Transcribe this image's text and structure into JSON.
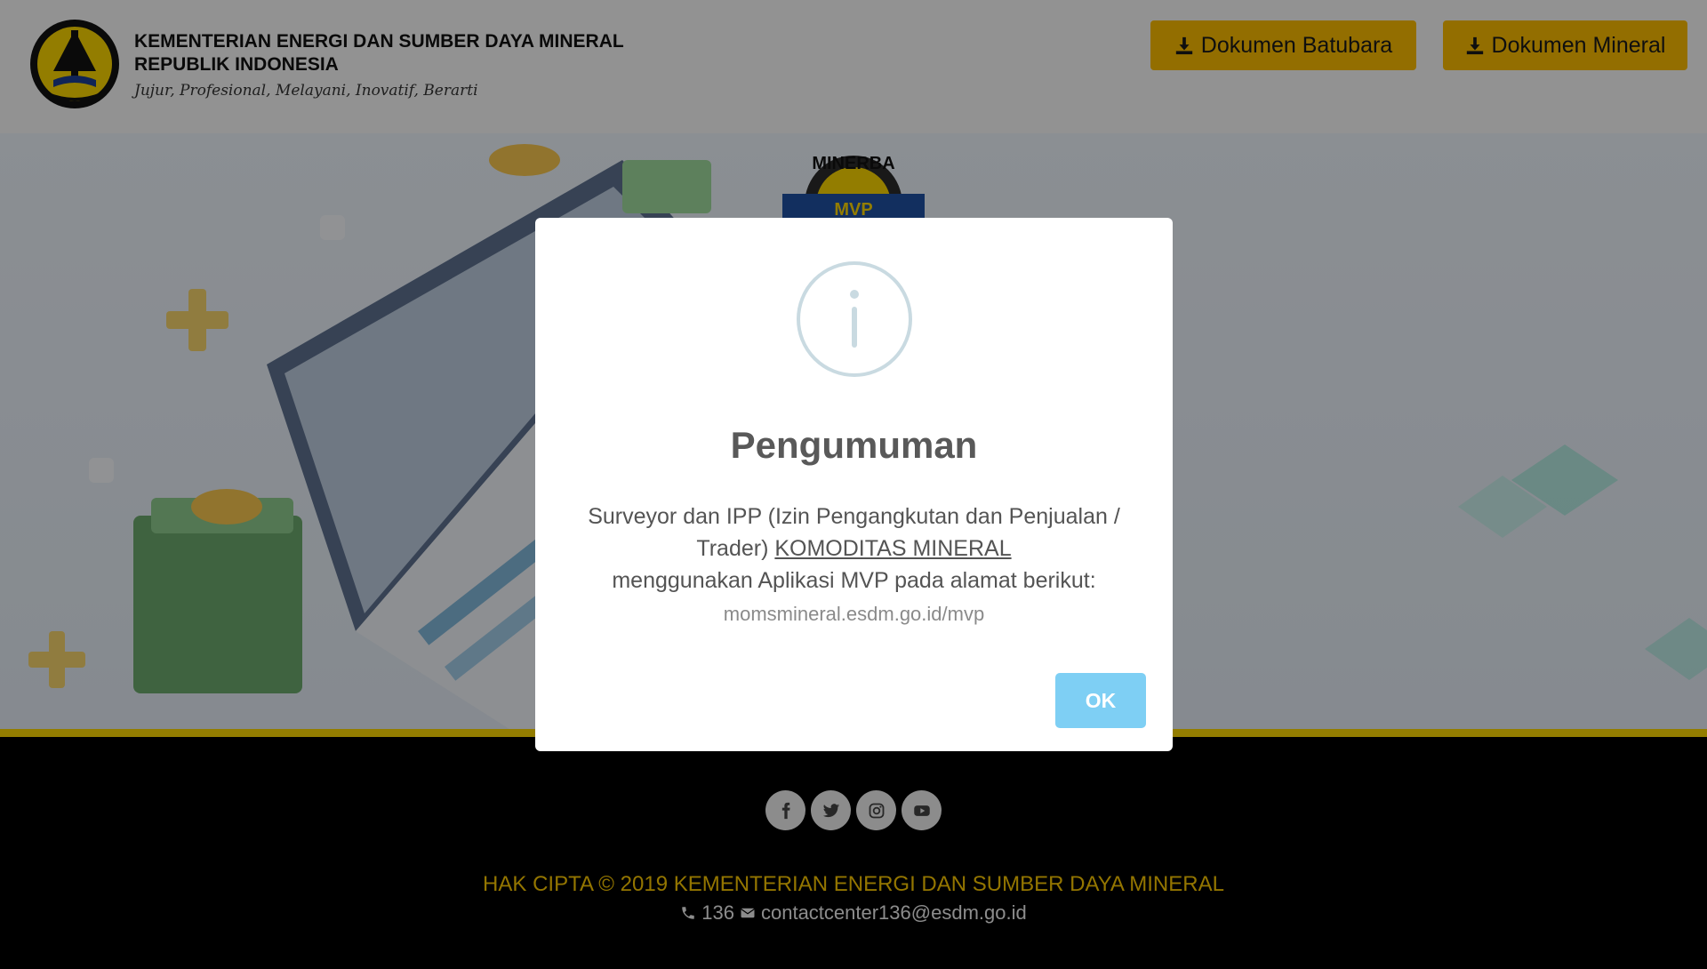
{
  "header": {
    "brand_line1": "KEMENTERIAN ENERGI DAN SUMBER DAYA MINERAL",
    "brand_line2": "REPUBLIK INDONESIA",
    "motto": "Jujur, Profesional, Melayani, Inovatif, Berarti",
    "btn_batubara": "Dokumen Batubara",
    "btn_mineral": "Dokumen Mineral"
  },
  "hero": {
    "badge_top": "MINERBA",
    "badge_ribbon": "MVP"
  },
  "modal": {
    "title": "Pengumuman",
    "body_part1": "Surveyor dan IPP (Izin Pengangkutan dan Penjualan / Trader) ",
    "body_link": "KOMODITAS MINERAL",
    "body_part2": "menggunakan Aplikasi MVP pada alamat berikut:",
    "url": "momsmineral.esdm.go.id/mvp",
    "ok_label": "OK"
  },
  "footer": {
    "socials": [
      "facebook-icon",
      "twitter-icon",
      "instagram-icon",
      "youtube-icon"
    ],
    "copyright": "HAK CIPTA © 2019 KEMENTERIAN ENERGI DAN SUMBER DAYA MINERAL",
    "phone": "136",
    "email": "contactcenter136@esdm.go.id"
  },
  "colors": {
    "accent_yellow": "#f5b700",
    "footer_yellow": "#f5c400",
    "ok_button": "#7ecff4",
    "info_icon": "#c9dae1"
  }
}
